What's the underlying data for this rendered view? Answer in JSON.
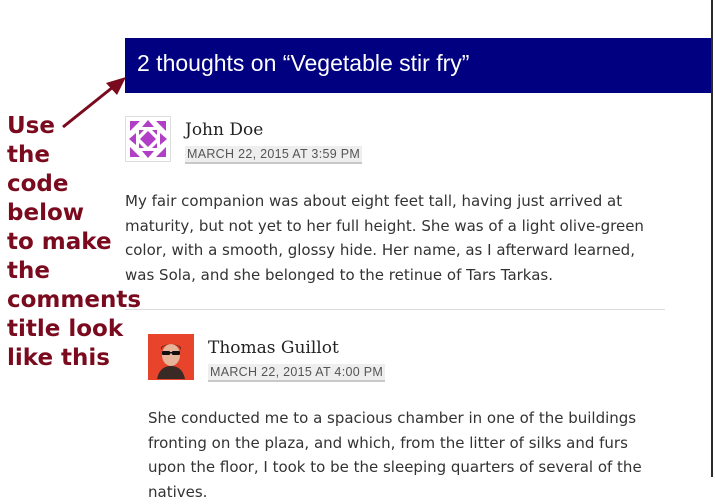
{
  "comments_title": "2 thoughts on “Vegetable stir fry”",
  "annotation": {
    "lines": [
      "Use",
      "the",
      "code",
      "below",
      "to make",
      "the",
      "comments",
      "title look",
      "like this"
    ],
    "color": "#7a0a1e"
  },
  "title_bar_color": "#000080",
  "comments": [
    {
      "author": "John Doe",
      "date": "MARCH 22, 2015 AT 3:59 PM",
      "avatar": "identicon-purple-avatar",
      "text": "My fair companion was about eight feet tall, having just arrived at maturity, but not yet to her full height. She was of a light olive-green color, with a smooth, glossy hide. Her name, as I afterward learned, was Sola, and she belonged to the retinue of Tars Tarkas."
    },
    {
      "author": "Thomas Guillot",
      "date": "MARCH 22, 2015 AT 4:00 PM",
      "avatar": "photo-avatar-red-background",
      "text": "She conducted me to a spacious chamber in one of the buildings fronting on the plaza, and which, from the litter of silks and furs upon the floor, I took to be the sleeping quarters of several of the natives."
    }
  ]
}
